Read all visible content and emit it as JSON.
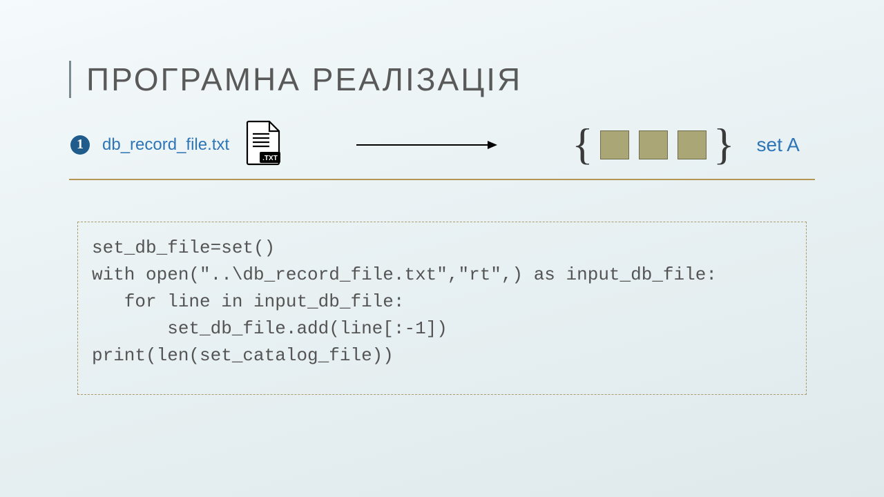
{
  "title": "ПРОГРАМНА РЕАЛІЗАЦІЯ",
  "step_number": "1",
  "filename": "db_record_file.txt",
  "file_ext_badge": ".TXT",
  "set_label": "set A",
  "code": "set_db_file=set()\nwith open(\"..\\db_record_file.txt\",\"rt\",) as input_db_file:\n   for line in input_db_file:\n       set_db_file.add(line[:-1])\nprint(len(set_catalog_file))"
}
